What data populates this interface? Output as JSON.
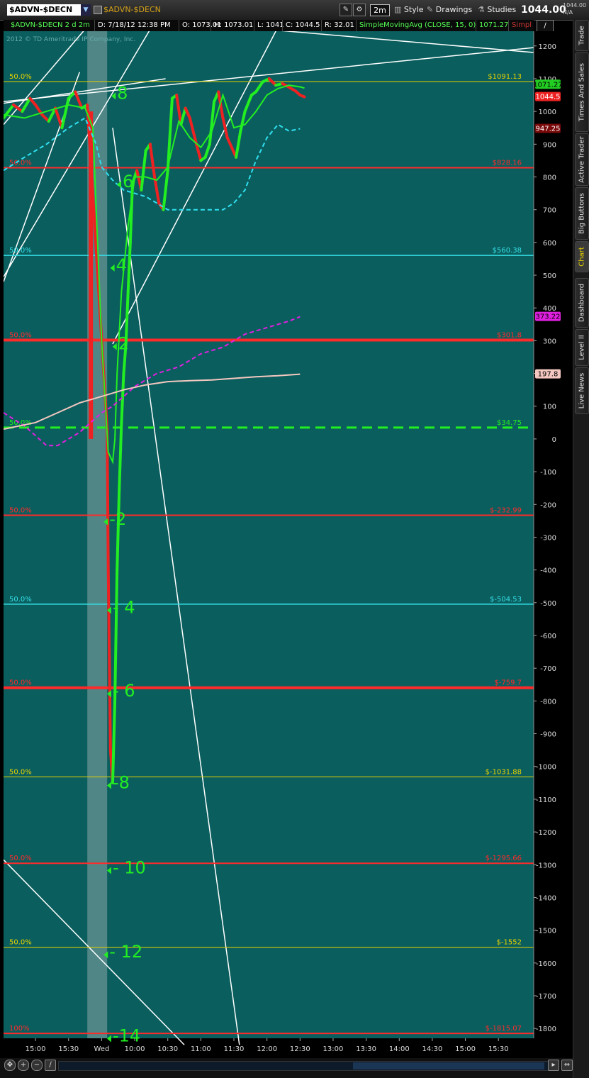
{
  "toolbar": {
    "symbol": "$ADVN-$DECN",
    "symbol_label": "$ADVN-$DECN",
    "period": "2m",
    "style_label": "Style",
    "drawings_label": "Drawings",
    "studies_label": "Studies",
    "last_price": "1044.00",
    "last_small_1": "1044.00",
    "last_small_2": "N/A"
  },
  "infobar": {
    "title": "$ADVN-$DECN 2 d 2m",
    "date": "D: 7/18/12 12:38 PM",
    "open": "O: 1073.01",
    "high": "H: 1073.01",
    "low": "L: 1041",
    "close": "C: 1044.5",
    "range": "R: 32.01",
    "study": "SimpleMovingAvg (CLOSE, 15, 0)",
    "study_value": "1071.27",
    "study_abbrev": "Simpl"
  },
  "sidebar": {
    "tabs": [
      "Trade",
      "Times And Sales",
      "Active Trader",
      "Big Buttons",
      "Chart",
      "Dashboard",
      "Level II",
      "Live News"
    ]
  },
  "chart_data": {
    "type": "line",
    "watermark": "2012 © TD Ameritrade IP Company, Inc.",
    "ylim": [
      -1800,
      1250
    ],
    "y_ticks": [
      1200,
      1100,
      1000,
      900,
      800,
      700,
      600,
      500,
      400,
      300,
      200,
      100,
      0,
      -100,
      -200,
      -300,
      -400,
      -500,
      -600,
      -700,
      -800,
      -900,
      -1000,
      -1100,
      -1200,
      -1300,
      -1400,
      -1500,
      -1600,
      -1700,
      -1800
    ],
    "y_tick_labels": [
      "1200",
      "1100",
      "1000",
      "900",
      "800",
      "700",
      "600",
      "500",
      "400",
      "300",
      "200",
      "100",
      "0",
      "-100",
      "-200",
      "-300",
      "-400",
      "-500",
      "-600",
      "-700",
      "-800",
      "-900",
      "-1000",
      "-1100",
      "-1200",
      "-1300",
      "-1400",
      "-1500",
      "-1600",
      "-1700",
      "-1800"
    ],
    "x_labels": [
      "15:00",
      "15:30",
      "Wed",
      "10:00",
      "10:30",
      "11:00",
      "11:30",
      "12:00",
      "12:30",
      "13:00",
      "13:30",
      "14:00",
      "14:30",
      "15:00",
      "15:30"
    ],
    "x_label_times": [
      0,
      30,
      60,
      90,
      120,
      150,
      180,
      210,
      240,
      270,
      300,
      330,
      360,
      390,
      420
    ],
    "xlim": [
      -29,
      452
    ],
    "session_break": [
      47,
      65
    ],
    "fib_levels": [
      {
        "price": 1091.13,
        "label": "$1091.13",
        "pct": "50.0%",
        "color": "#e6d200",
        "width": 1
      },
      {
        "price": 828.16,
        "label": "$828.16",
        "pct": "50.0%",
        "color": "#ff2a2a",
        "width": 2
      },
      {
        "price": 560.38,
        "label": "$560.38",
        "pct": "50.0%",
        "color": "#35e0e8",
        "width": 1.5
      },
      {
        "price": 301.8,
        "label": "$301.8",
        "pct": "50.0%",
        "color": "#ff2a2a",
        "width": 4
      },
      {
        "price": 34.75,
        "label": "$34.75",
        "pct": "50.0%",
        "color": "#22ee22",
        "width": 3,
        "dashed": true
      },
      {
        "price": -232.99,
        "label": "$-232.99",
        "pct": "50.0%",
        "color": "#ff2a2a",
        "width": 2
      },
      {
        "price": -504.53,
        "label": "$-504.53",
        "pct": "50.0%",
        "color": "#35e0e8",
        "width": 1.5
      },
      {
        "price": -759.7,
        "label": "$-759.7",
        "pct": "50.0%",
        "color": "#ff2a2a",
        "width": 4
      },
      {
        "price": -1031.88,
        "label": "$-1031.88",
        "pct": "50.0%",
        "color": "#e6d200",
        "width": 1
      },
      {
        "price": -1295.66,
        "label": "$-1295.66",
        "pct": "50.0%",
        "color": "#ff2a2a",
        "width": 2
      },
      {
        "price": -1552,
        "label": "$-1552",
        "pct": "50.0%",
        "color": "#e6d200",
        "width": 1
      },
      {
        "price": -1815,
        "label": "$-1815.07",
        "pct": "100%",
        "color": "#ff2a2a",
        "width": 2
      }
    ],
    "count_labels": [
      {
        "text": "8",
        "t": 74,
        "price": 1060
      },
      {
        "text": "6",
        "t": 79,
        "price": 790
      },
      {
        "text": "4",
        "t": 73,
        "price": 535
      },
      {
        "text": "2",
        "t": 75,
        "price": 295
      },
      {
        "text": "-2",
        "t": 67,
        "price": -240
      },
      {
        "text": "- 4",
        "t": 70,
        "price": -510
      },
      {
        "text": "- 6",
        "t": 70,
        "price": -765
      },
      {
        "text": "-8",
        "t": 70,
        "price": -1045
      },
      {
        "text": "- 10",
        "t": 70,
        "price": -1305
      },
      {
        "text": "- 12",
        "t": 67,
        "price": -1562
      },
      {
        "text": "-14",
        "t": 70,
        "price": -1818
      }
    ],
    "price_tags": [
      {
        "label": "1071.27",
        "price": 1082,
        "bg": "#22cc22",
        "fg": "#000"
      },
      {
        "label": "1044.5",
        "price": 1044.5,
        "bg": "#ee2222",
        "fg": "#fff"
      },
      {
        "label": "947.25",
        "price": 947.25,
        "bg": "#7a0a0a",
        "fg": "#fff"
      },
      {
        "label": "373.22",
        "price": 373.22,
        "bg": "#e020e0",
        "fg": "#000"
      },
      {
        "label": "197.8",
        "price": 197.8,
        "bg": "#f4c8c0",
        "fg": "#000"
      }
    ],
    "series": [
      {
        "name": "$ADVN-$DECN",
        "color": "#22ee22",
        "x": [
          -29,
          -20,
          -12,
          -5,
          0,
          6,
          12,
          18,
          24,
          30,
          36,
          42,
          47,
          65,
          66,
          68,
          70,
          72,
          74,
          76,
          78,
          80,
          82,
          84,
          86,
          88,
          92,
          96,
          100,
          104,
          108,
          112,
          116,
          120,
          124,
          128,
          132,
          136,
          140,
          146,
          150,
          154,
          158,
          162,
          166,
          170,
          174,
          178,
          182,
          186,
          190,
          196,
          200,
          206,
          212,
          218,
          224,
          230,
          236,
          240,
          244
        ],
        "y": [
          980,
          1020,
          1000,
          1040,
          1020,
          990,
          970,
          1010,
          950,
          1040,
          1060,
          1010,
          1020,
          30,
          -400,
          -950,
          -1050,
          -800,
          -400,
          -150,
          50,
          200,
          290,
          450,
          600,
          780,
          820,
          760,
          880,
          900,
          800,
          720,
          700,
          820,
          1040,
          1050,
          960,
          1010,
          980,
          900,
          850,
          860,
          900,
          1030,
          1060,
          980,
          920,
          890,
          860,
          940,
          1000,
          1050,
          1060,
          1090,
          1100,
          1080,
          1085,
          1074,
          1062,
          1050,
          1044.5
        ]
      },
      {
        "name": "SimpleMovingAvg (CLOSE, 15, 0)",
        "color": "#22ee22",
        "x": [
          -29,
          -10,
          10,
          30,
          45,
          52,
          60,
          66,
          70,
          72,
          74,
          78,
          84,
          90,
          100,
          110,
          120,
          130,
          140,
          150,
          160,
          170,
          180,
          190,
          200,
          210,
          220,
          230,
          240,
          244
        ],
        "y": [
          990,
          980,
          1000,
          1020,
          1010,
          950,
          300,
          -40,
          -70,
          0,
          200,
          450,
          650,
          800,
          800,
          790,
          830,
          970,
          920,
          890,
          940,
          1050,
          950,
          960,
          1000,
          1050,
          1070,
          1080,
          1075,
          1071.27
        ]
      },
      {
        "name": "SMA 30",
        "color": "#30e0f0",
        "dashed": true,
        "x": [
          -29,
          -10,
          10,
          30,
          45,
          55,
          60,
          70,
          80,
          90,
          100,
          110,
          120,
          130,
          140,
          150,
          160,
          170,
          180,
          190,
          200,
          210,
          220,
          230,
          240
        ],
        "y": [
          820,
          860,
          900,
          950,
          980,
          900,
          830,
          790,
          760,
          750,
          740,
          720,
          700,
          700,
          700,
          700,
          700,
          700,
          720,
          760,
          850,
          920,
          960,
          940,
          947.25
        ]
      },
      {
        "name": "Magenta",
        "color": "#e020e0",
        "dashed": true,
        "x": [
          -29,
          -10,
          0,
          10,
          20,
          30,
          40,
          50,
          60,
          70,
          80,
          90,
          100,
          110,
          120,
          130,
          140,
          150,
          160,
          170,
          180,
          190,
          200,
          210,
          220,
          230,
          240
        ],
        "y": [
          80,
          40,
          10,
          -20,
          -20,
          0,
          20,
          50,
          80,
          100,
          130,
          160,
          180,
          200,
          210,
          220,
          240,
          260,
          270,
          280,
          300,
          320,
          330,
          340,
          350,
          360,
          373.22
        ]
      },
      {
        "name": "Pink",
        "color": "#f4c8c0",
        "width": 2,
        "x": [
          -29,
          0,
          20,
          40,
          60,
          80,
          100,
          120,
          140,
          160,
          180,
          200,
          220,
          240
        ],
        "y": [
          30,
          50,
          80,
          110,
          130,
          150,
          165,
          175,
          178,
          180,
          185,
          190,
          193,
          197.8
        ]
      }
    ]
  }
}
